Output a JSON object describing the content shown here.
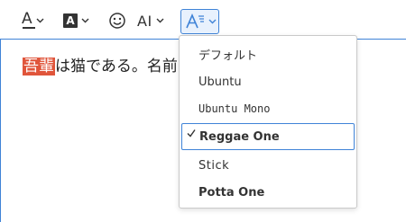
{
  "toolbar": {
    "font_color": {
      "glyph": "A",
      "icon": "font-color-icon"
    },
    "background_color": {
      "glyph": "A",
      "icon": "background-color-icon"
    },
    "emoji": {
      "icon": "smiley-icon"
    },
    "font_size": {
      "glyph": "AI",
      "icon": "font-size-icon"
    },
    "font_family": {
      "glyph": "A",
      "icon": "font-family-icon"
    }
  },
  "editor": {
    "highlighted_text": "吾輩",
    "text_rest": "は猫である。名前"
  },
  "font_menu": {
    "items": [
      {
        "label": "デフォルト",
        "selected": false
      },
      {
        "label": "Ubuntu",
        "selected": false
      },
      {
        "label": "Ubuntu Mono",
        "selected": false
      },
      {
        "label": "Reggae One",
        "selected": true
      },
      {
        "label": "Stick",
        "selected": false
      },
      {
        "label": "Potta One",
        "selected": false
      }
    ]
  },
  "colors": {
    "accent": "#3f83d7",
    "highlight": "#e0553b",
    "icon": "#333333"
  }
}
